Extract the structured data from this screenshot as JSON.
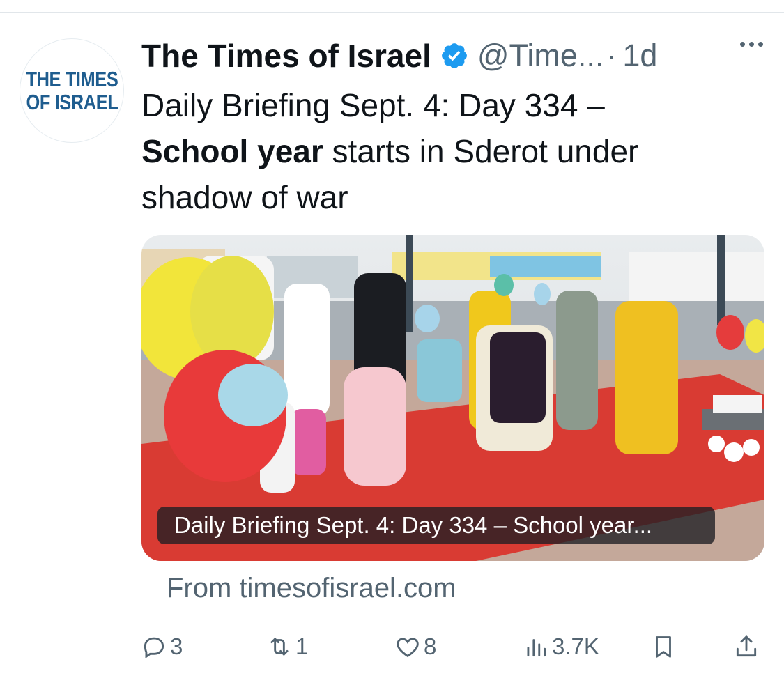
{
  "tweet": {
    "author": {
      "name": "The Times of Israel",
      "handle": "@Time...",
      "timestamp": "1d",
      "separator": "·",
      "avatar_lines": [
        "THE TIMES",
        "OF ISRAEL"
      ]
    },
    "text": {
      "line1": "Daily Briefing Sept. 4: Day 334 –",
      "bold": "School year",
      "rest": " starts in Sderot under shadow of war"
    },
    "link_card": {
      "caption": "Daily Briefing Sept. 4: Day 334 – School year...",
      "source": "From timesofisrael.com"
    },
    "actions": {
      "replies": "3",
      "reposts": "1",
      "likes": "8",
      "views": "3.7K"
    }
  },
  "colors": {
    "text_primary": "#0f1419",
    "text_secondary": "#536471",
    "verified_blue": "#1d9bf0",
    "brand_blue": "#1f5d8f"
  },
  "icons": [
    "verified-badge-icon",
    "more-icon",
    "reply-icon",
    "repost-icon",
    "like-icon",
    "views-icon",
    "bookmark-icon",
    "share-icon"
  ]
}
